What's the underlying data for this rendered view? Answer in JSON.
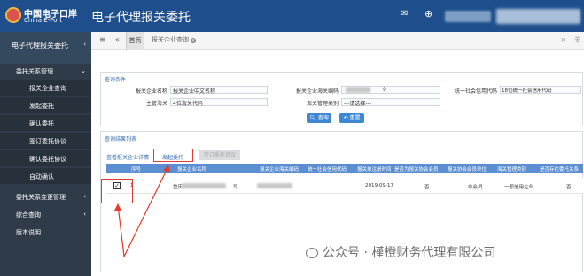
{
  "header": {
    "logo_cn": "中国电子口岸",
    "logo_en": "China E-Port",
    "app_title": "电子代理报关委托",
    "mail_icon": "mail-icon",
    "user_icon": "user-icon"
  },
  "sidebar": {
    "top_label": "电子代理报关委托",
    "groups": [
      {
        "label": "委托关系管理",
        "expanded": true,
        "items": [
          "报关企业查询",
          "发起委托",
          "确认委托",
          "签订委托协议",
          "确认委托协议",
          "自动确认"
        ]
      },
      {
        "label": "委托关系变更管理"
      },
      {
        "label": "综合查询"
      },
      {
        "label": "版本说明"
      }
    ]
  },
  "tabbar": {
    "home": "首页",
    "tab": "报关企业查询",
    "close_all": "关"
  },
  "search_panel": {
    "title": "查询条件",
    "fields": [
      {
        "label": "报关企业名称",
        "value": "报关企业中文名称"
      },
      {
        "label": "报关企业海关编码",
        "value": "9"
      },
      {
        "label": "统一社会信用代码",
        "value": "18位统一社会信用代码"
      },
      {
        "label": "主管海关",
        "value": "4位海关代码"
      },
      {
        "label": "海关管理类别",
        "value": "---请选择---"
      }
    ],
    "query_btn": "查询",
    "reset_btn": "重置"
  },
  "result_panel": {
    "title": "查询结果列表",
    "links": [
      "查看报关企业详情",
      "发起委托",
      "签订委托协议"
    ],
    "columns": [
      "序号",
      "报关企业名称",
      "报关企业海关编码",
      "统一社会信用代码",
      "报关单注册时间",
      "是否为报关协会会员",
      "报关协会会员单位",
      "海关管理类别",
      "是否存在委托关系"
    ],
    "rows": [
      {
        "checked": true,
        "index": "1",
        "name": "重庆",
        "name_suffix": "司",
        "reg_date": "2019-09-17",
        "member": "否",
        "assoc": "非会员",
        "category": "一般信用企业",
        "relation": "否"
      }
    ]
  },
  "watermark": "公众号 · 槿橙财务代理有限公司",
  "colors": {
    "header_bg": "#1e4f8c",
    "sidebar_bg": "#2f3b48",
    "table_head": "#5b8fd1",
    "accent": "#3f86d4",
    "highlight": "#e23a2e"
  }
}
